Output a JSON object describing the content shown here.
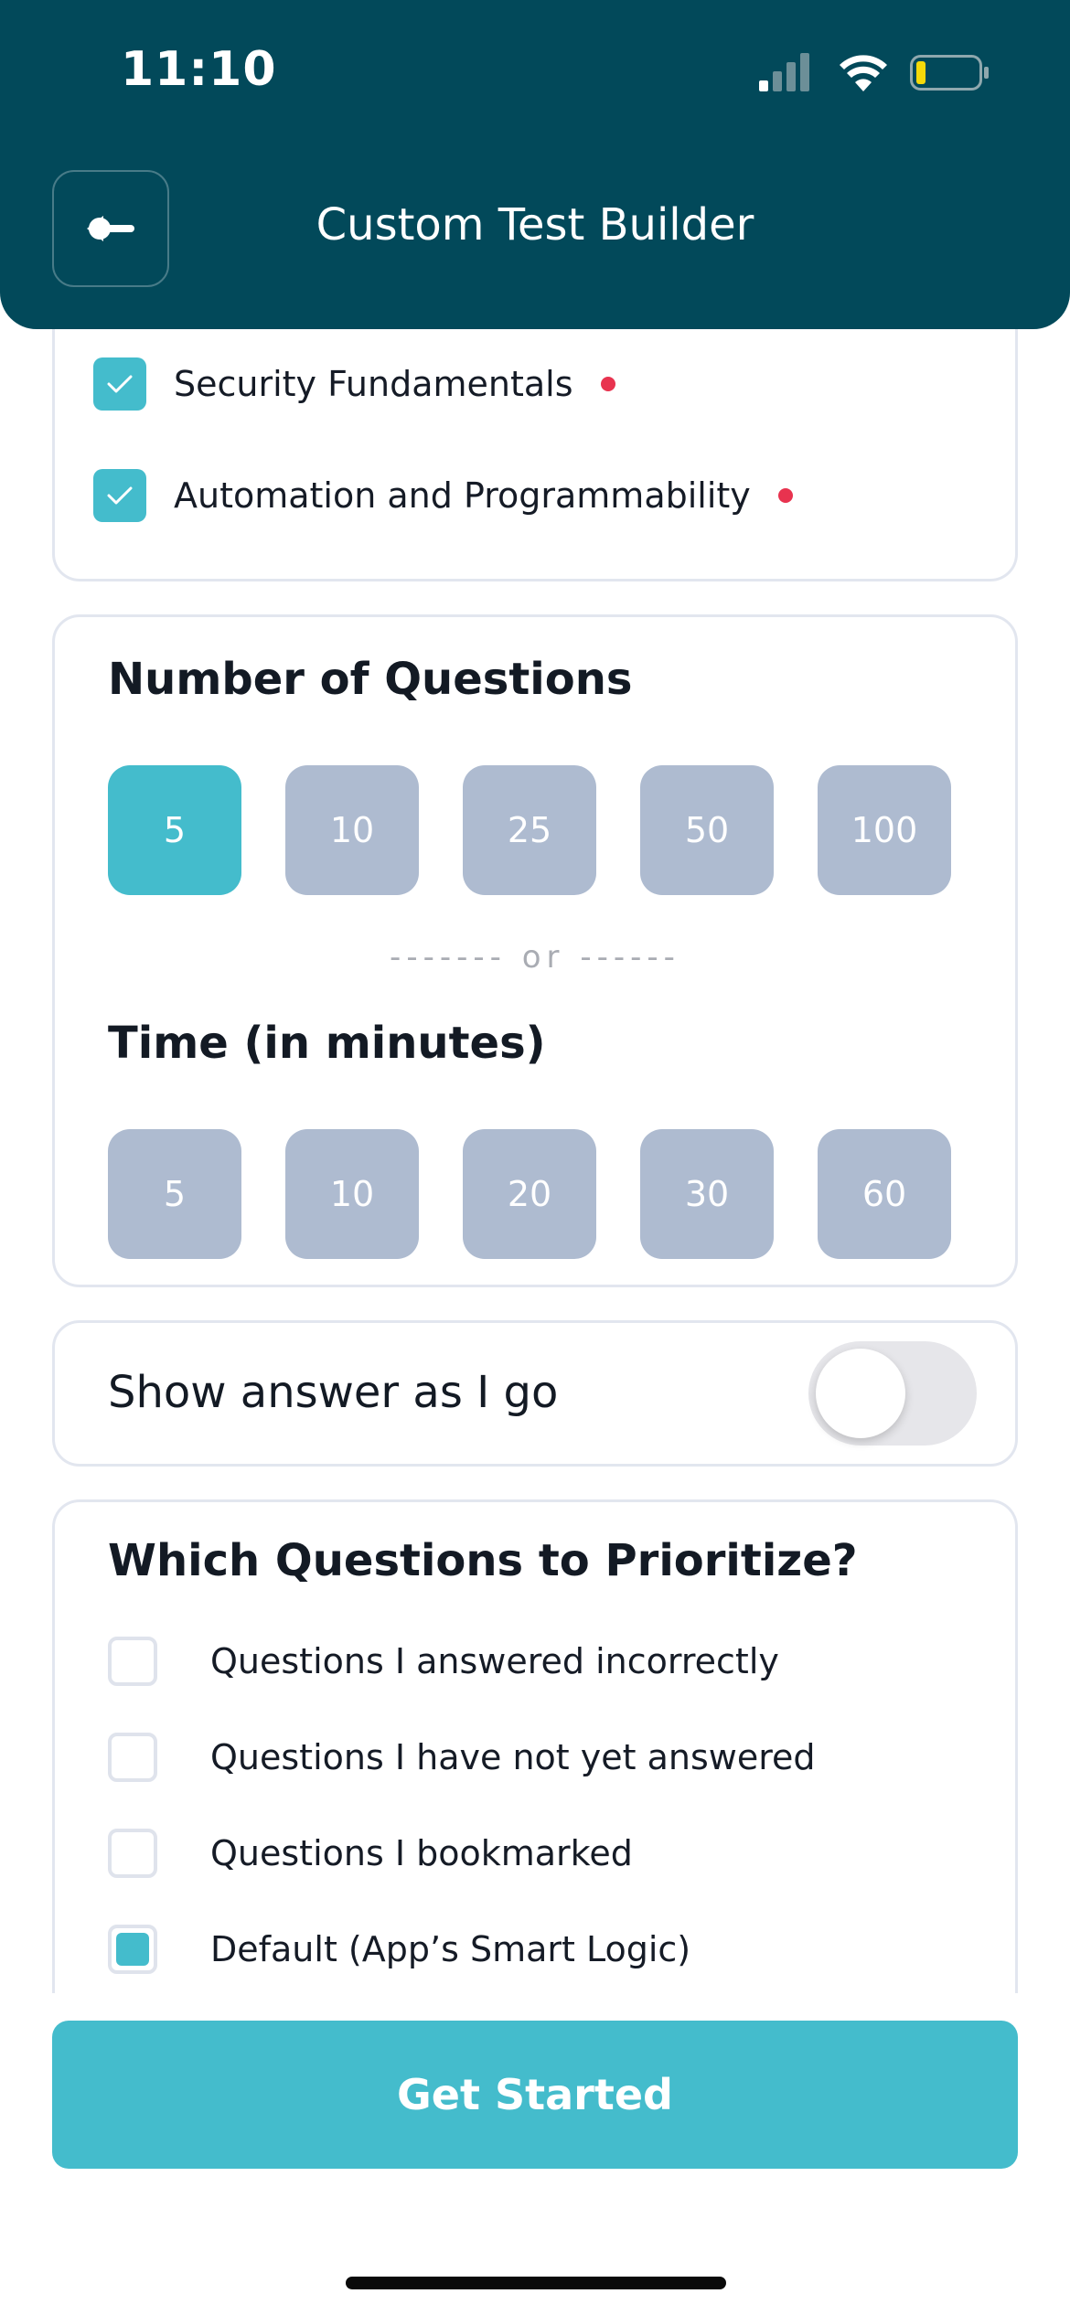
{
  "status_bar": {
    "time": "11:10"
  },
  "header": {
    "title": "Custom Test Builder",
    "back_icon": "arrow-left-icon"
  },
  "topics": {
    "items": [
      {
        "label": "Security Fundamentals",
        "checked": true
      },
      {
        "label": "Automation and Programmability",
        "checked": true
      }
    ]
  },
  "question_count": {
    "title": "Number of Questions",
    "options": [
      "5",
      "10",
      "25",
      "50",
      "100"
    ],
    "selected": "5"
  },
  "divider": {
    "text": "------- or ------"
  },
  "time_limit": {
    "title": "Time (in minutes)",
    "options": [
      "5",
      "10",
      "20",
      "30",
      "60"
    ],
    "selected": null
  },
  "show_answer": {
    "label": "Show answer as I go",
    "enabled": false
  },
  "prioritize": {
    "title": "Which Questions to Prioritize?",
    "options": [
      {
        "label": "Questions I answered incorrectly",
        "checked": false
      },
      {
        "label": "Questions I have not yet answered",
        "checked": false
      },
      {
        "label": "Questions I bookmarked",
        "checked": false
      },
      {
        "label": "Default (App’s Smart Logic)",
        "checked": true
      }
    ]
  },
  "cta": {
    "label": "Get Started"
  },
  "colors": {
    "header_bg": "#02495a",
    "accent": "#44bccc",
    "chip_inactive": "#aebbd0",
    "indicator_red": "#e8334f",
    "battery_yellow": "#f5d90a"
  }
}
